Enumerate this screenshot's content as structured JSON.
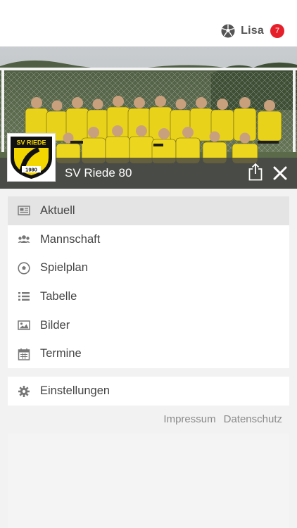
{
  "user": {
    "name": "Lisa",
    "notifications": "7"
  },
  "team": {
    "name": "SV Riede 80",
    "logo_top": "SV RIEDE",
    "logo_year": "1980"
  },
  "menu": {
    "items": [
      {
        "label": "Aktuell",
        "icon": "news-icon",
        "active": true
      },
      {
        "label": "Mannschaft",
        "icon": "team-icon"
      },
      {
        "label": "Spielplan",
        "icon": "soccer-ball-icon"
      },
      {
        "label": "Tabelle",
        "icon": "list-icon"
      },
      {
        "label": "Bilder",
        "icon": "image-icon"
      },
      {
        "label": "Termine",
        "icon": "calendar-icon"
      }
    ],
    "settings_label": "Einstellungen"
  },
  "footer": {
    "impressum": "Impressum",
    "datenschutz": "Datenschutz"
  },
  "colors": {
    "badge": "#e5202a",
    "jersey": "#e8d21a",
    "logo_black": "#111111",
    "logo_yellow": "#f3d500"
  }
}
